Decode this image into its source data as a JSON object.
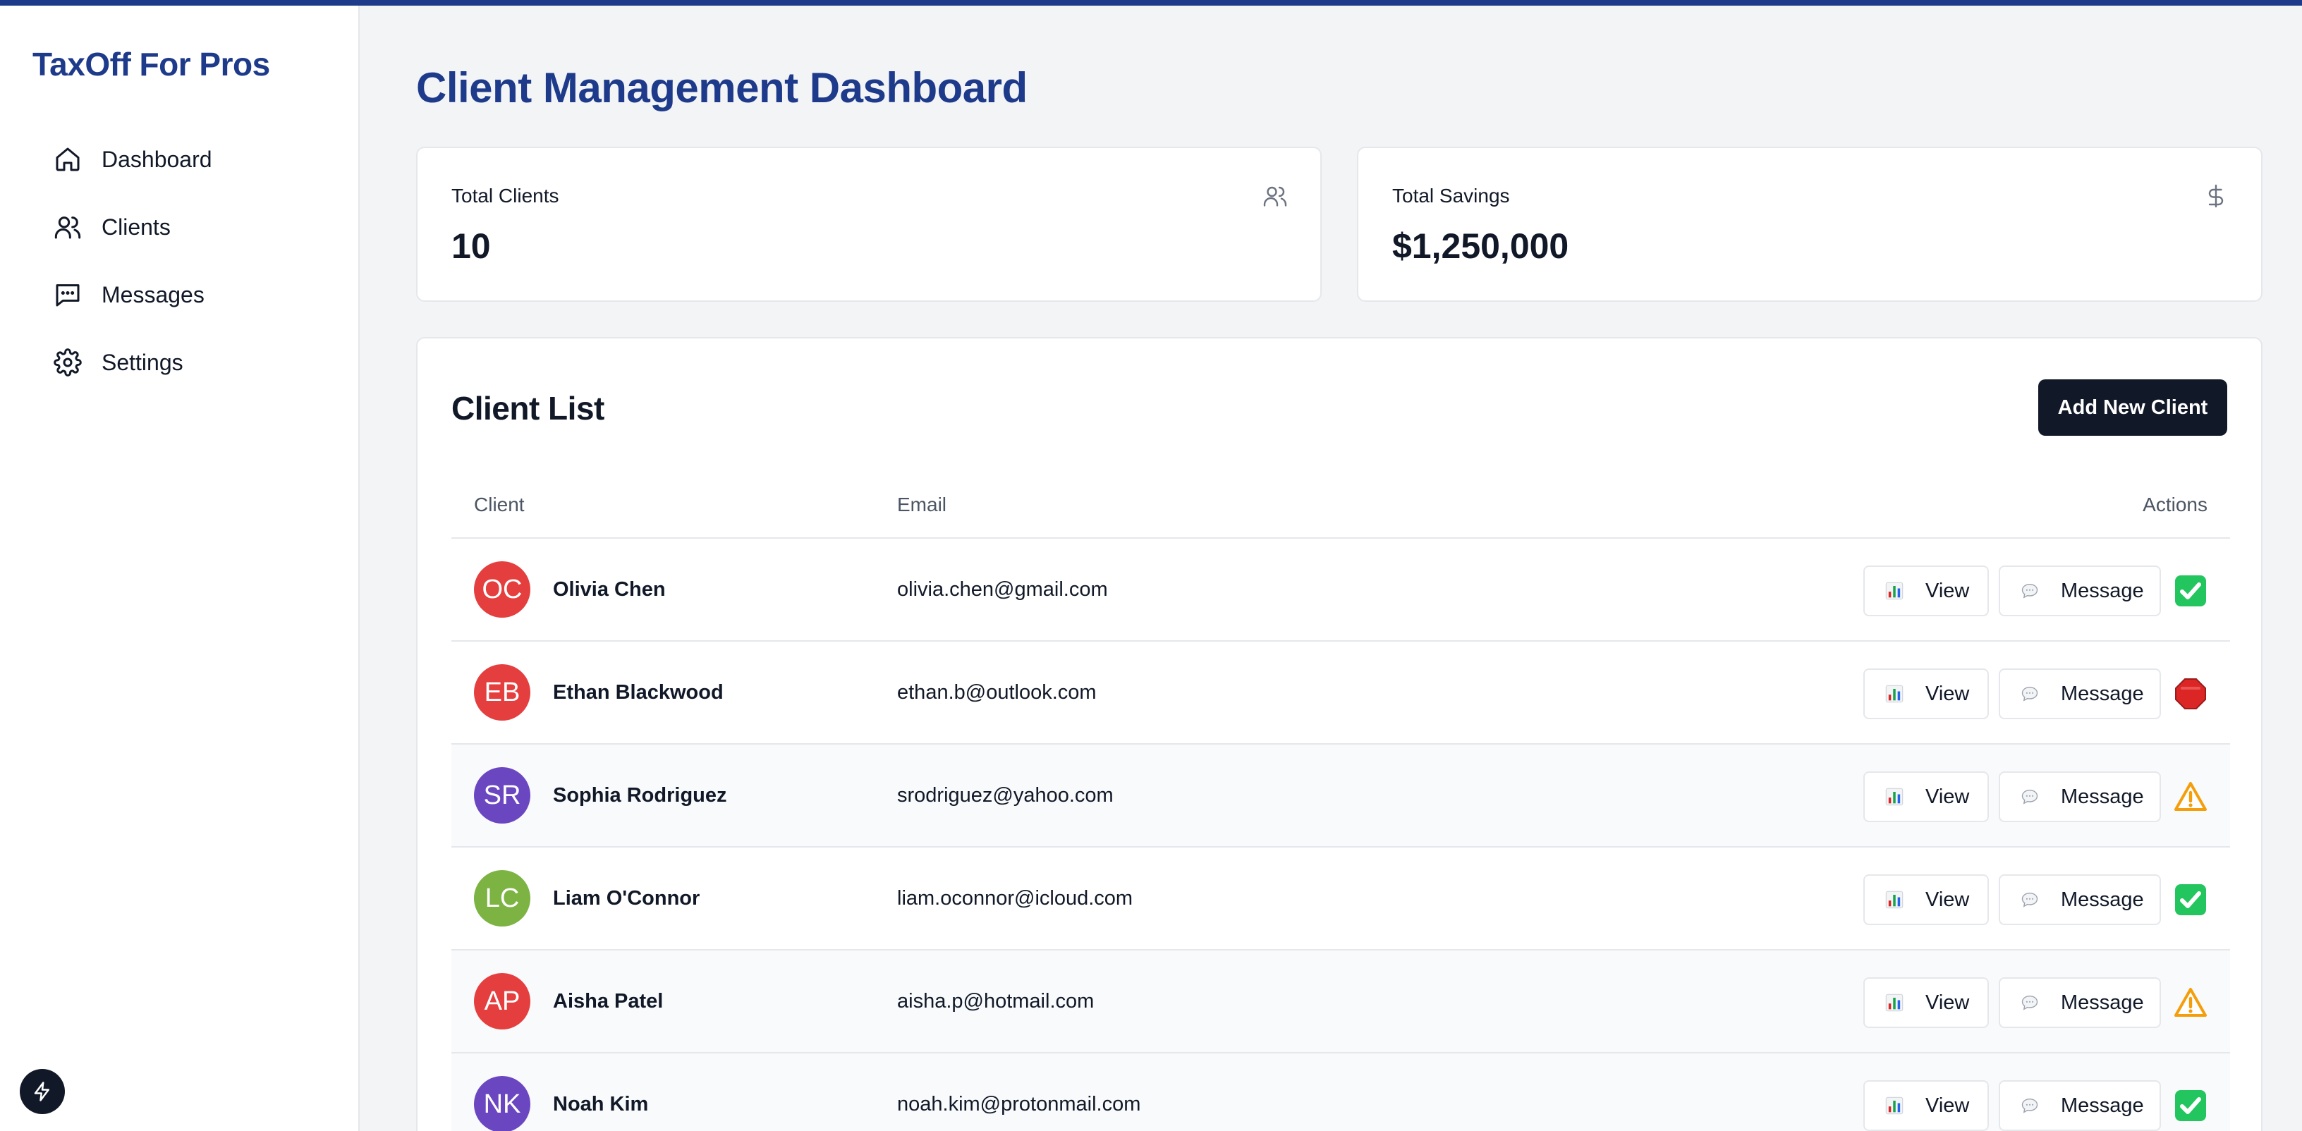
{
  "brand": "TaxOff For Pros",
  "nav": [
    {
      "label": "Dashboard",
      "icon": "home-icon"
    },
    {
      "label": "Clients",
      "icon": "users-icon"
    },
    {
      "label": "Messages",
      "icon": "message-square-icon"
    },
    {
      "label": "Settings",
      "icon": "gear-icon"
    }
  ],
  "page_title": "Client Management Dashboard",
  "stats": {
    "total_clients": {
      "label": "Total Clients",
      "value": "10",
      "icon": "users-icon"
    },
    "total_savings": {
      "label": "Total Savings",
      "value": "$1,250,000",
      "icon": "dollar-icon"
    }
  },
  "client_list": {
    "title": "Client List",
    "add_button": "Add New Client",
    "columns": {
      "client": "Client",
      "email": "Email",
      "actions": "Actions"
    },
    "view_label": "View",
    "message_label": "Message",
    "rows": [
      {
        "initials": "OC",
        "name": "Olivia Chen",
        "email": "olivia.chen@gmail.com",
        "avatar_color": "#e53e3e",
        "status": "check"
      },
      {
        "initials": "EB",
        "name": "Ethan Blackwood",
        "email": "ethan.b@outlook.com",
        "avatar_color": "#e53e3e",
        "status": "stop"
      },
      {
        "initials": "SR",
        "name": "Sophia Rodriguez",
        "email": "srodriguez@yahoo.com",
        "avatar_color": "#6b46c1",
        "status": "warning"
      },
      {
        "initials": "LC",
        "name": "Liam O'Connor",
        "email": "liam.oconnor@icloud.com",
        "avatar_color": "#7cb342",
        "status": "check"
      },
      {
        "initials": "AP",
        "name": "Aisha Patel",
        "email": "aisha.p@hotmail.com",
        "avatar_color": "#e53e3e",
        "status": "warning"
      },
      {
        "initials": "NK",
        "name": "Noah Kim",
        "email": "noah.kim@protonmail.com",
        "avatar_color": "#6b46c1",
        "status": "check"
      }
    ]
  },
  "colors": {
    "accent": "#1e3a8a",
    "primary_button": "#111827"
  }
}
